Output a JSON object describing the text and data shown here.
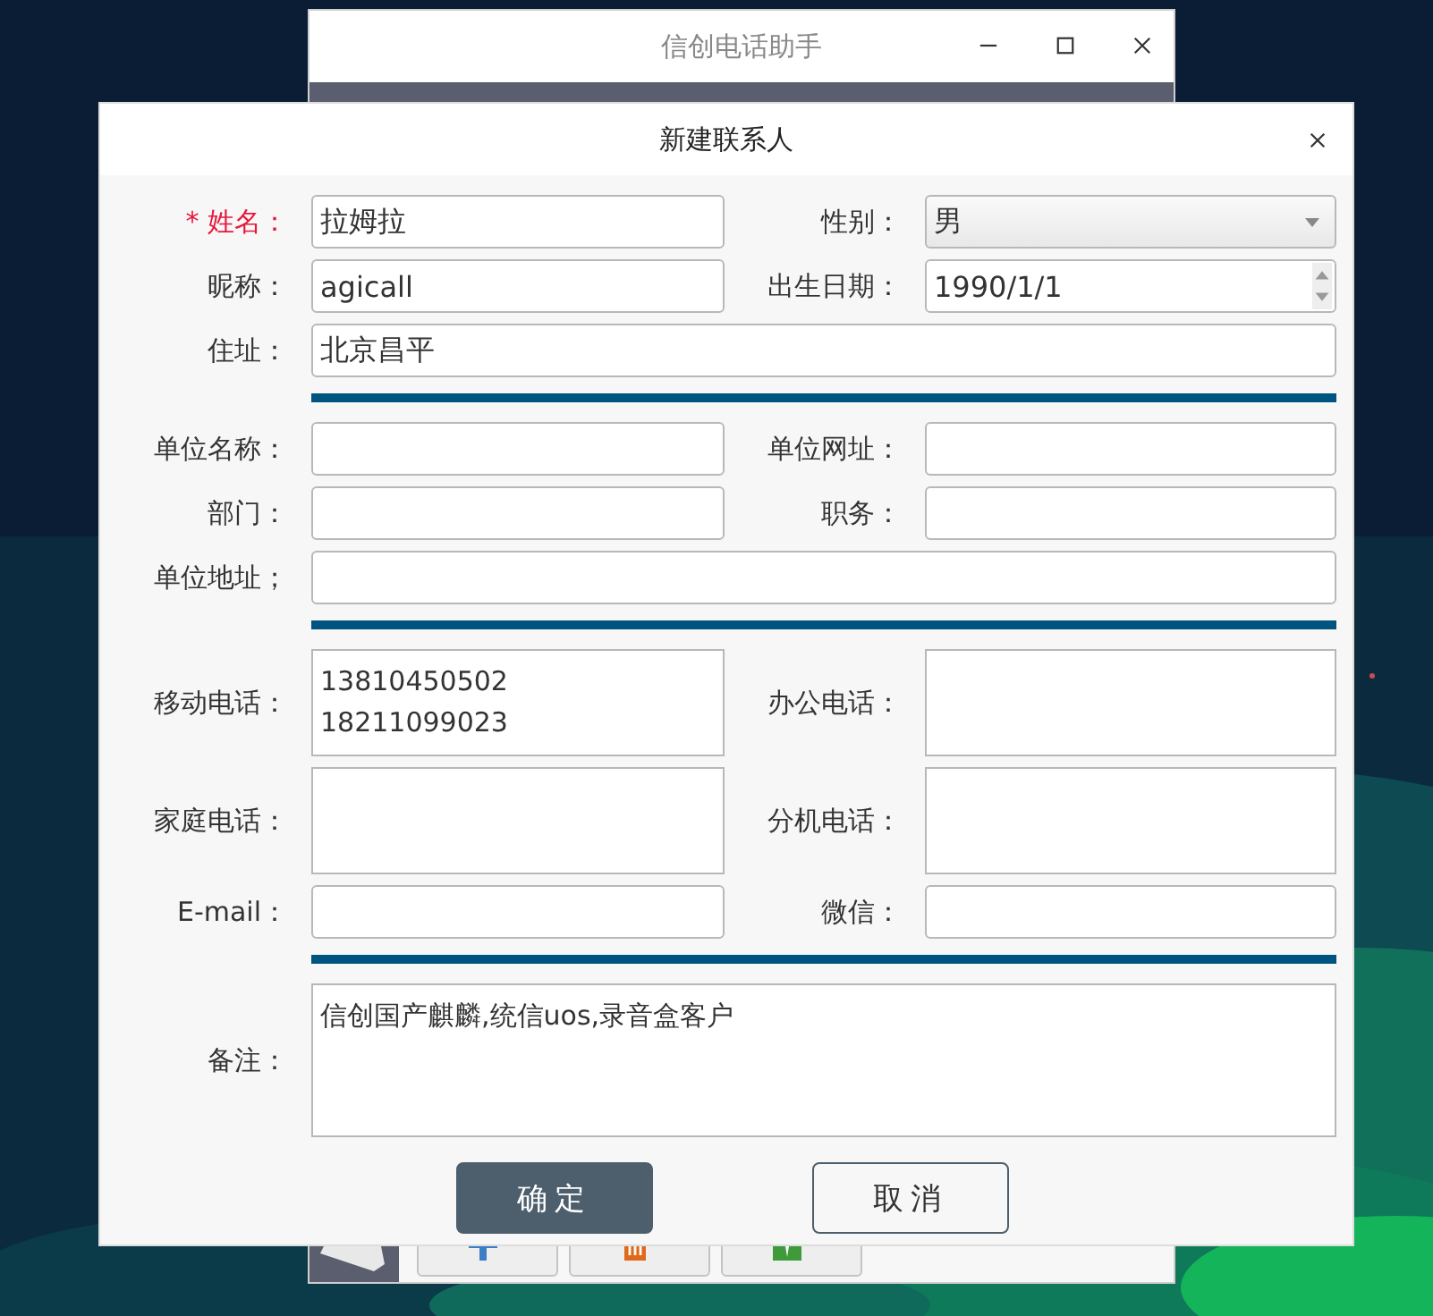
{
  "main_window": {
    "title": "信创电话助手",
    "toolbar": [
      {
        "kind": "add"
      },
      {
        "kind": "delete"
      },
      {
        "kind": "view"
      }
    ]
  },
  "dialog": {
    "title": "新建联系人",
    "sections": [
      {
        "rows": [
          {
            "fields": [
              {
                "label": "* 姓名：",
                "required": true,
                "kind": "text",
                "value": "拉姆拉"
              },
              {
                "label": "性别：",
                "required": false,
                "kind": "select",
                "value": "男"
              }
            ]
          },
          {
            "fields": [
              {
                "label": "昵称：",
                "required": false,
                "kind": "text",
                "value": "agicall"
              },
              {
                "label": "出生日期：",
                "required": false,
                "kind": "spin",
                "value": "1990/1/1"
              }
            ]
          },
          {
            "fields": [
              {
                "label": "住址：",
                "required": false,
                "kind": "text",
                "value": "北京昌平"
              }
            ]
          }
        ]
      },
      {
        "rows": [
          {
            "fields": [
              {
                "label": "单位名称：",
                "required": false,
                "kind": "text"
              },
              {
                "label": "单位网址：",
                "required": false,
                "kind": "text"
              }
            ]
          },
          {
            "fields": [
              {
                "label": "部门：",
                "required": false,
                "kind": "text"
              },
              {
                "label": "职务：",
                "required": false,
                "kind": "text"
              }
            ]
          },
          {
            "fields": [
              {
                "label": "单位地址；",
                "required": false,
                "kind": "text"
              }
            ]
          }
        ]
      },
      {
        "rows": [
          {
            "fields": [
              {
                "label": "移动电话：",
                "required": false,
                "kind": "multiline",
                "lines": [
                  "13810450502",
                  "18211099023"
                ]
              },
              {
                "label": "办公电话：",
                "required": false,
                "kind": "multiline"
              }
            ]
          },
          {
            "fields": [
              {
                "label": "家庭电话：",
                "required": false,
                "kind": "multiline"
              },
              {
                "label": "分机电话：",
                "required": false,
                "kind": "multiline"
              }
            ]
          },
          {
            "fields": [
              {
                "label": "E-mail：",
                "required": false,
                "kind": "text"
              },
              {
                "label": "微信：",
                "required": false,
                "kind": "text"
              }
            ]
          }
        ]
      },
      {
        "rows": [
          {
            "fields": [
              {
                "label": "备注：",
                "required": false,
                "kind": "note",
                "value": "信创国产麒麟,统信uos,录音盒客户"
              }
            ]
          }
        ]
      }
    ],
    "buttons": [
      {
        "label": "确定",
        "primary": true
      },
      {
        "label": "取消",
        "primary": false
      }
    ]
  }
}
